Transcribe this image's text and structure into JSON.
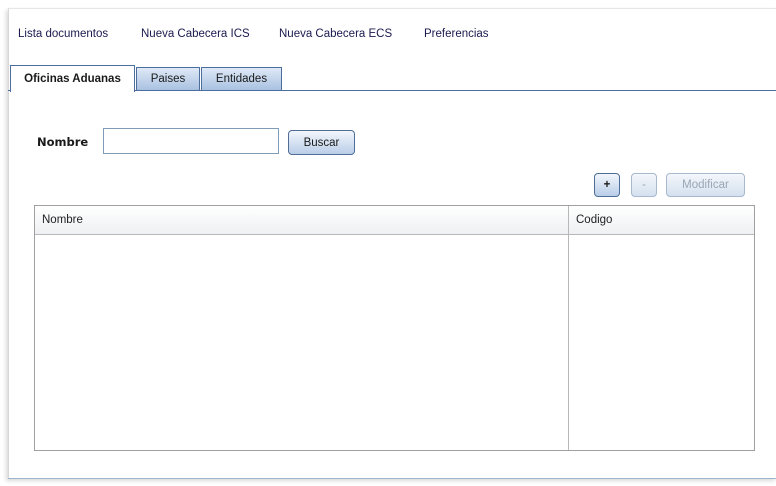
{
  "nav": {
    "links": [
      "Lista documentos",
      "Nueva Cabecera ICS",
      "Nueva Cabecera ECS",
      "Preferencias"
    ]
  },
  "tabs": [
    {
      "label": "Oficinas Aduanas",
      "active": true
    },
    {
      "label": "Paises",
      "active": false
    },
    {
      "label": "Entidades",
      "active": false
    }
  ],
  "search": {
    "label": "Nombre",
    "value": "",
    "placeholder": "",
    "button_label": "Buscar"
  },
  "toolbar": {
    "add_label": "+",
    "remove_label": "-",
    "modify_label": "Modificar"
  },
  "table": {
    "columns": [
      "Nombre",
      "Codigo"
    ],
    "rows": []
  }
}
